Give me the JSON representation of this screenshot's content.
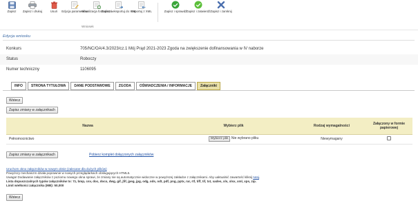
{
  "toolbar": {
    "buttons": [
      {
        "label": "Zapisz",
        "icon": "save-icon"
      },
      {
        "label": "Zapisz i drukuj",
        "icon": "print-icon"
      },
      {
        "label": "Usuń",
        "icon": "delete-icon"
      },
      {
        "label": "Edycja parametrów",
        "icon": "edit-params-icon"
      },
      {
        "label": "Aktualizacja formularza",
        "icon": "refresh-form-icon"
      },
      {
        "label": "Zapisz i eksportuj do XML",
        "icon": "export-xml-icon"
      },
      {
        "label": "Importuj z XML",
        "icon": "import-xml-icon"
      },
      {
        "label": "Zapisz i sprawdź",
        "icon": "check-icon"
      },
      {
        "label": "Zapisz i zatwierdź",
        "icon": "approve-icon"
      },
      {
        "label": "Zapisz i zamknij",
        "icon": "close-icon"
      }
    ],
    "group_label": "Wniosek"
  },
  "section_title": "Edycja wniosku",
  "info": {
    "konkurs_label": "Konkurs",
    "konkurs_value": "705/NC/OA/4.3/2023/cz.1 Mój Prąd 2021-2023 Zgoda na zwiększenie dofinansowania w IV naborze",
    "status_label": "Status",
    "status_value": "Roboczy",
    "numer_label": "Numer techniczny",
    "numer_value": "1106095"
  },
  "tabs": [
    {
      "label": "INFO",
      "active": false
    },
    {
      "label": "STRONA TYTUŁOWA",
      "active": false
    },
    {
      "label": "DANE PODSTAWOWE",
      "active": false
    },
    {
      "label": "ZGODA",
      "active": false
    },
    {
      "label": "OŚWIADCZENIA / INFORMACJE",
      "active": false
    },
    {
      "label": "Załączniki",
      "active": true
    }
  ],
  "buttons": {
    "back_label": "Wstecz",
    "save_attachments_label": "Zapisz zmiany w załącznikach"
  },
  "table": {
    "headers": {
      "name": "Nazwa",
      "choose": "Wybierz plik",
      "type": "Rodzaj wymagalności",
      "paper": "Załączony w formie papierowej"
    },
    "rows": [
      {
        "name": "Pełnomocnictwo",
        "file_button": "Wybierz plik",
        "file_status": "Nie wybrano pliku",
        "type": "Niewymagany"
      }
    ]
  },
  "download_all_label": "Pobierz komplet dołączonych załączników",
  "notes": {
    "new_window_link": "Uruchom okno załączników w nowym oknie (zalecane dla dużych plików)",
    "line2": "Powyższy mechanizm działa poprawnie w nowych przeglądarkach obsługujących HTML5.",
    "line3_prefix": "Uwaga! Dodawanie załączników z poziomu nowego okna sprawi, że zmiany nie są automatycznie widoczne w powyższej zakładce z załącznikami. Aby uaktualnić zawartość kliknij ",
    "line3_link": "tutaj",
    "line4": "Lista dopuszczalnych typów załączników to: 7z, bmp, csv, doc, docx, dwg, gif, jfif, jpeg, jpg, odg, ods, odt, pdf, png, pptx, rar, rtf, tiff, tif, txt, xades, xls, xlsx, xml, xps, zip.",
    "line5": "Limit wielkości załącznika (MB): 50,000"
  }
}
